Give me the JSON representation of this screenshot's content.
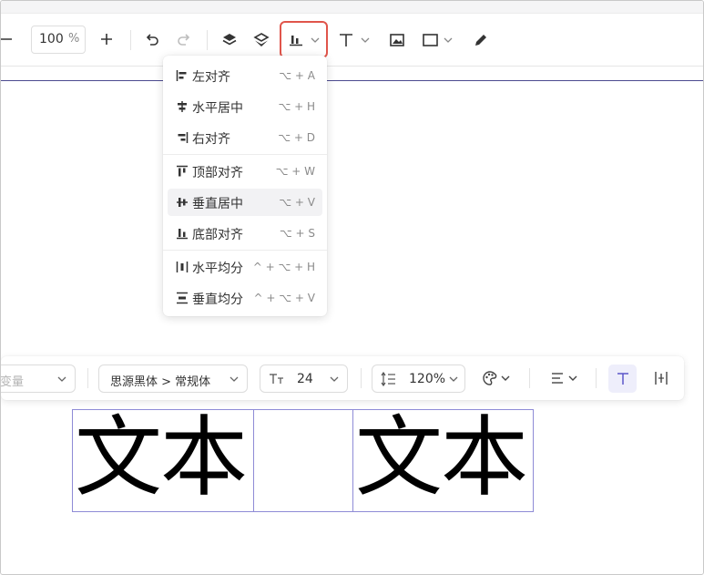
{
  "toolbar": {
    "zoom_value": "100",
    "zoom_unit": "%"
  },
  "align_menu": {
    "items": [
      {
        "label": "左对齐",
        "shortcut": "⌥ + A"
      },
      {
        "label": "水平居中",
        "shortcut": "⌥ + H"
      },
      {
        "label": "右对齐",
        "shortcut": "⌥ + D"
      },
      {
        "label": "顶部对齐",
        "shortcut": "⌥ + W"
      },
      {
        "label": "垂直居中",
        "shortcut": "⌥ + V"
      },
      {
        "label": "底部对齐",
        "shortcut": "⌥ + S"
      },
      {
        "label": "水平均分",
        "shortcut": "^ + ⌥ + H"
      },
      {
        "label": "垂直均分",
        "shortcut": "^ + ⌥ + V"
      }
    ],
    "hovered_item": "垂直居中"
  },
  "text_toolbar": {
    "variable_placeholder": "变量",
    "font_family": "思源黑体 > 常规体",
    "font_size": "24",
    "line_height": "120%"
  },
  "canvas": {
    "text_box_1": "文本",
    "text_box_2": "文本"
  },
  "colors": {
    "highlight_border": "#e0554b",
    "selection_border": "#8e8bd6",
    "active_toggle_bg": "#eeeefb",
    "active_toggle_fg": "#5b57c9"
  }
}
